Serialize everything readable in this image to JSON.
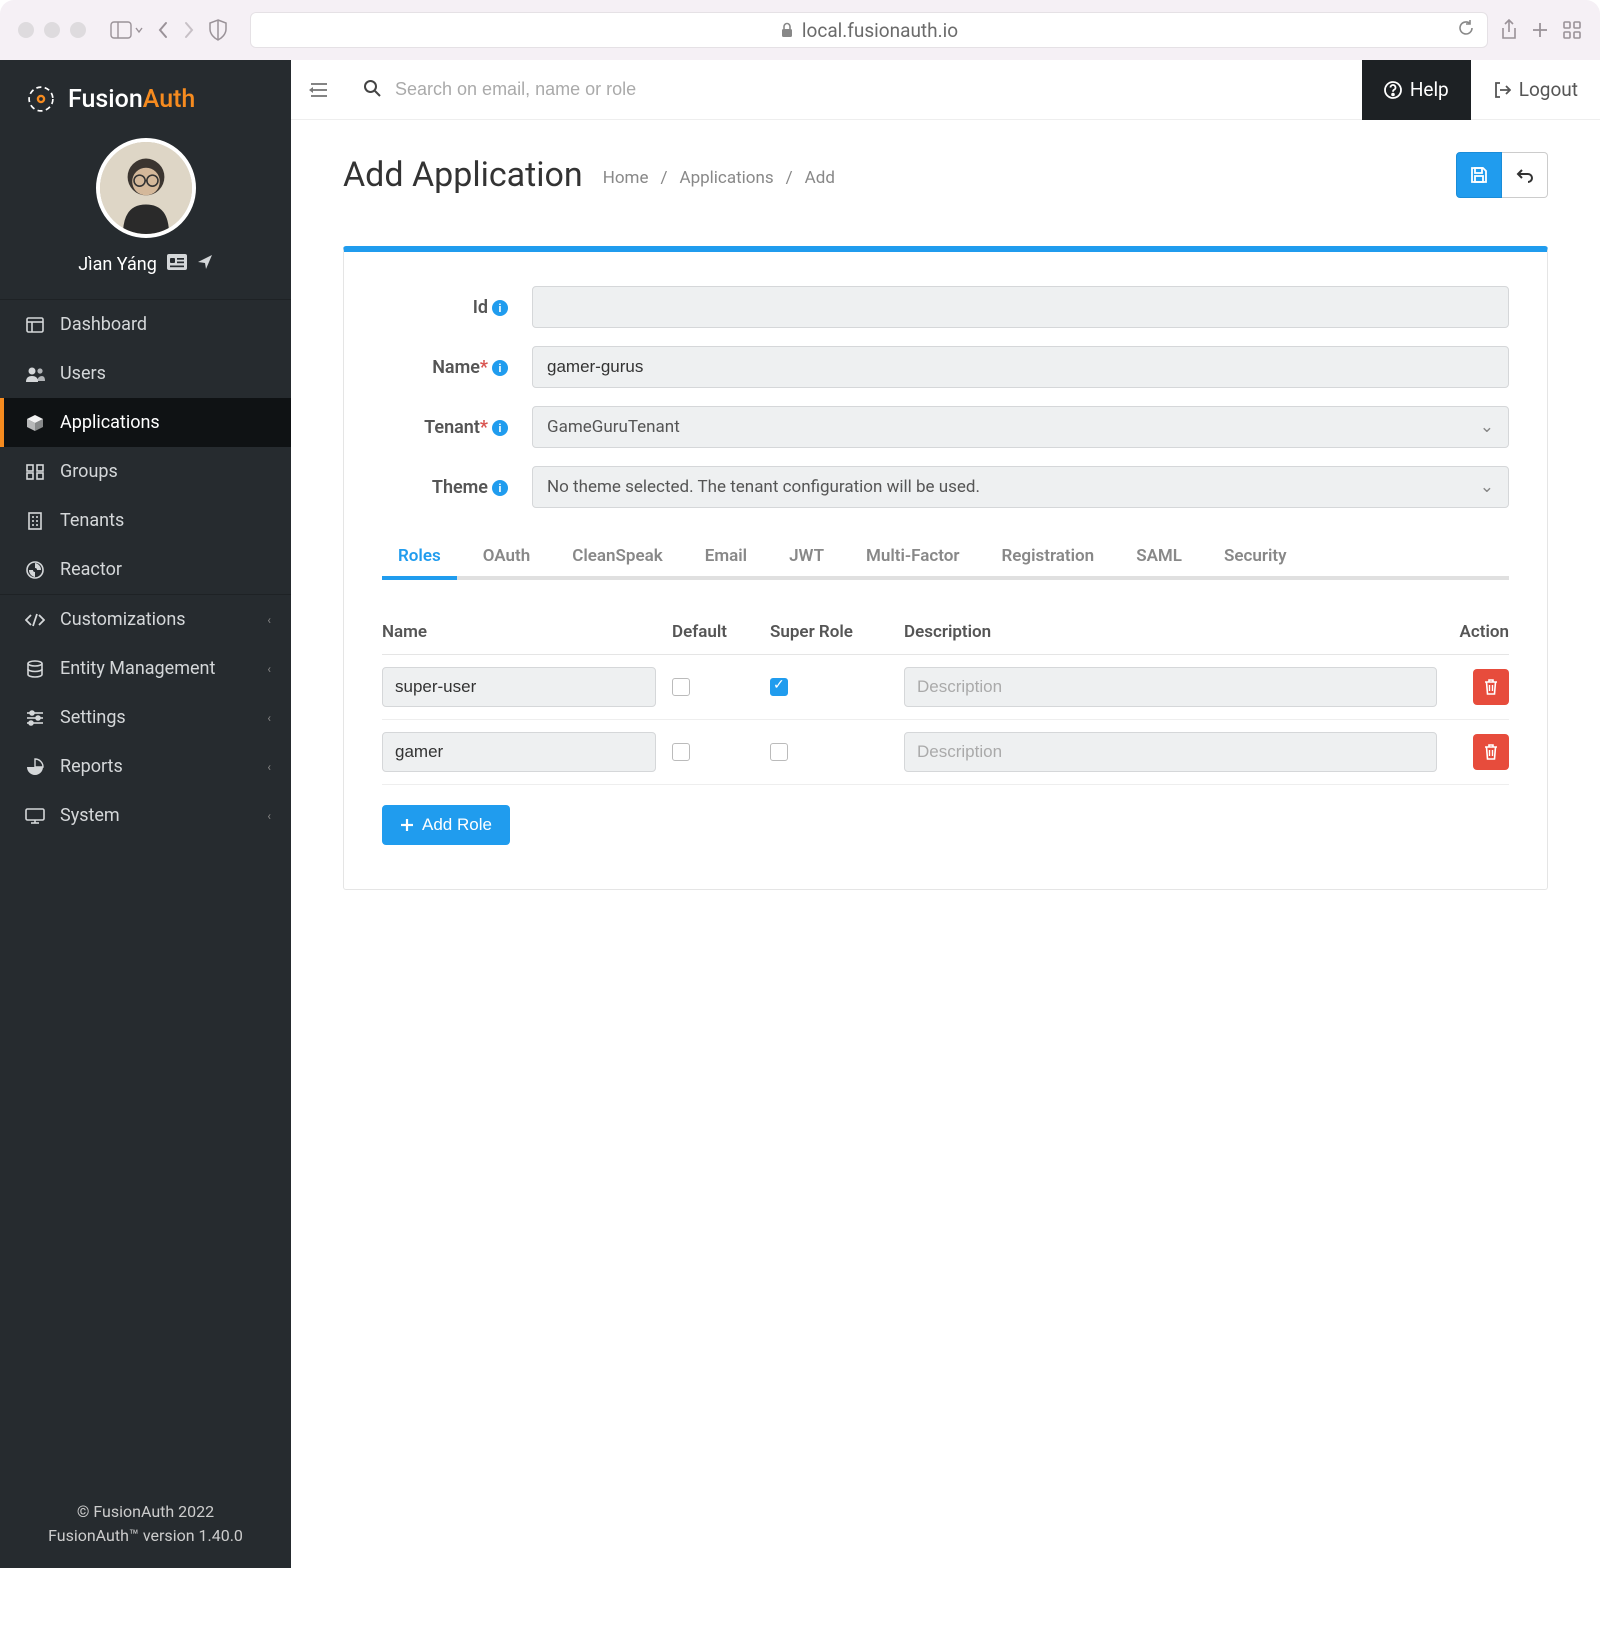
{
  "browser": {
    "url": "local.fusionauth.io"
  },
  "brand": {
    "name_a": "Fusion",
    "name_b": "Auth"
  },
  "user": {
    "name": "Jìan Yáng"
  },
  "nav": {
    "items": [
      {
        "label": "Dashboard"
      },
      {
        "label": "Users"
      },
      {
        "label": "Applications"
      },
      {
        "label": "Groups"
      },
      {
        "label": "Tenants"
      },
      {
        "label": "Reactor"
      }
    ],
    "subs": [
      {
        "label": "Customizations"
      },
      {
        "label": "Entity Management"
      },
      {
        "label": "Settings"
      },
      {
        "label": "Reports"
      },
      {
        "label": "System"
      }
    ]
  },
  "footer": {
    "line1": "© FusionAuth 2022",
    "line2": "FusionAuth™ version 1.40.0"
  },
  "topbar": {
    "search_placeholder": "Search on email, name or role",
    "help": "Help",
    "logout": "Logout"
  },
  "page": {
    "title": "Add Application",
    "breadcrumb": [
      "Home",
      "Applications",
      "Add"
    ]
  },
  "form": {
    "id_label": "Id",
    "name_label": "Name",
    "tenant_label": "Tenant",
    "theme_label": "Theme",
    "name_value": "gamer-gurus",
    "tenant_value": "GameGuruTenant",
    "theme_value": "No theme selected. The tenant configuration will be used."
  },
  "tabs": [
    "Roles",
    "OAuth",
    "CleanSpeak",
    "Email",
    "JWT",
    "Multi-Factor",
    "Registration",
    "SAML",
    "Security"
  ],
  "roles": {
    "headers": {
      "name": "Name",
      "default": "Default",
      "super": "Super Role",
      "desc": "Description",
      "action": "Action"
    },
    "desc_placeholder": "Description",
    "rows": [
      {
        "name": "super-user",
        "default": false,
        "super": true,
        "desc": ""
      },
      {
        "name": "gamer",
        "default": false,
        "super": false,
        "desc": ""
      }
    ],
    "add_label": "Add Role"
  }
}
